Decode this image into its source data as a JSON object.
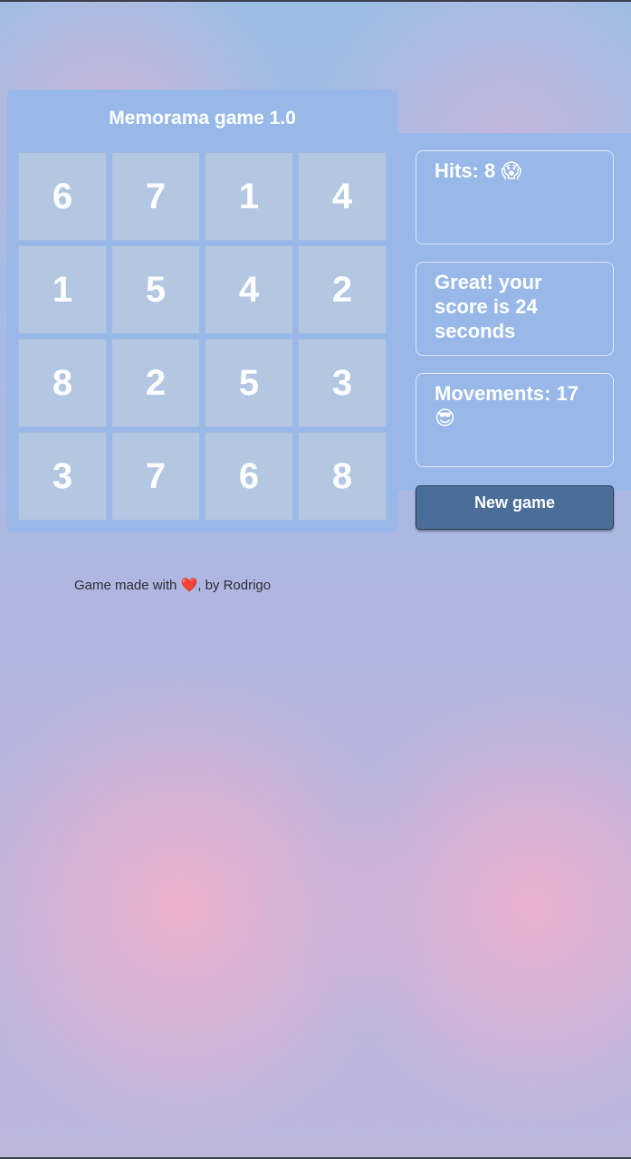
{
  "game": {
    "title": "Memorama game 1.0",
    "cards": [
      "6",
      "7",
      "1",
      "4",
      "1",
      "5",
      "4",
      "2",
      "8",
      "2",
      "5",
      "3",
      "3",
      "7",
      "6",
      "8"
    ]
  },
  "stats": {
    "hits_text": "Hits: 8",
    "hits_emoji": "😱",
    "score_text": "Great! your score is 24 seconds",
    "moves_text": "Movements: 17",
    "moves_emoji": "😎"
  },
  "actions": {
    "new_game_label": "New game"
  },
  "footer": {
    "prefix": "Game made with ",
    "heart": "❤️",
    "suffix": ", by Rodrigo"
  },
  "colors": {
    "panel": "#97b8e8",
    "cell": "#b3c6e2",
    "button": "#4a6d9a",
    "text": "#ffffff"
  }
}
